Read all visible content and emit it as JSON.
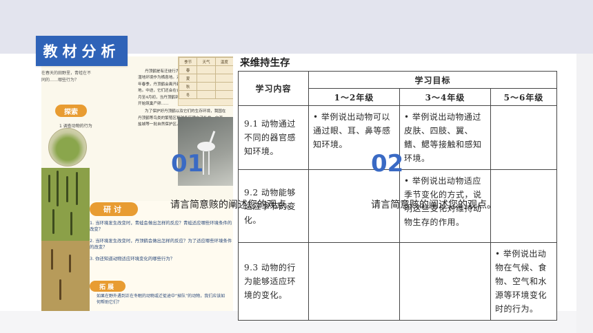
{
  "slide": {
    "title": "教材分析",
    "markers": [
      {
        "number": "01",
        "caption": "请言简意赅的阐述您的观点。"
      },
      {
        "number": "02",
        "caption": "请言简意赅的阐述您的观点。"
      }
    ]
  },
  "textbook": {
    "side_note": "在春天的田野里，青蛙在不同的……哪些行为？",
    "tag_explore": "探索",
    "side_line": "1  调查动物的行为",
    "body": [
      "丹顶鹤是有迁徙行为的鸟类，需要洁净而开阔的湿地环境作为栖息地。对湿地环境变化非常敏感。每年春季，丹顶鹤会离开越冬的地方迁往东北的繁殖地。中途，它们还会在合适的地方做短暂的栖息。3月至4月初，当丹顶鹤到达繁殖地后不久，它们就会开始筑巢产卵……",
      "为了保护好丹顶鹤以及它们的生存环境，我国在丹顶鹤等鸟类的繁殖区和越冬区建立了扎龙、向海、盐城等一批自然保护区。"
    ],
    "tag_discuss": "研讨",
    "questions": [
      "1. 当环境发生改变时，青蛙会做出怎样的反应？青蛙适应哪些环境条件的改变？",
      "2. 当环境发生改变时，丹顶鹤会做出怎样的反应？为了适应哪些环境条件的改变？",
      "3. 你还知道动物适应环境变化的哪些行为？"
    ],
    "tag_expand": "拓展",
    "expand_text": "如果在野外遇到正在冬眠的动物或迁徙途中“掉队”的动物，我们应该如何帮助它们？",
    "grid_header": [
      "季节",
      "天气",
      "温度"
    ],
    "grid_rows": [
      "春",
      "夏",
      "秋",
      "冬"
    ]
  },
  "standards": {
    "title": "来维持生存",
    "header_content": "学习内容",
    "header_goal": "学习目标",
    "grades": [
      "1～2年级",
      "3～4年级",
      "5～6年级"
    ],
    "rows": [
      {
        "content": "9.1 动物通过不同的器官感知环境。",
        "g12": "• 举例说出动物可以通过眼、耳、鼻等感知环境。",
        "g34": "• 举例说出动物通过皮肤、四肢、翼、鳍、鳃等接触和感知环境。",
        "g56": ""
      },
      {
        "content": "9.2 动物能够适应季节的变化。",
        "g12": "",
        "g34": "• 举例说出动物适应季节变化的方式，说明这些变化对维持动物生存的作用。",
        "g56": ""
      },
      {
        "content": "9.3 动物的行为能够适应环境的变化。",
        "g12": "",
        "g34": "",
        "g56": "• 举例说出动物在气候、食物、空气和水源等环境变化时的行为。"
      }
    ]
  }
}
